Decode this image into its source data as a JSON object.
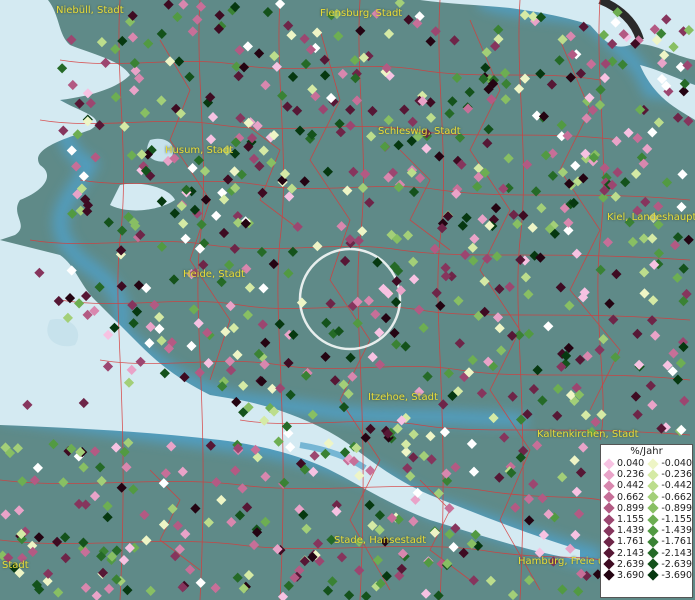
{
  "map": {
    "cities": [
      {
        "label": "Niebüll, Stadt"
      },
      {
        "label": "Flensburg, Stadt"
      },
      {
        "label": "Schleswig, Stadt"
      },
      {
        "label": "Husum, Stadt"
      },
      {
        "label": "Kiel, Landeshauptstadt"
      },
      {
        "label": "Heide, Stadt"
      },
      {
        "label": "Itzehoe, Stadt"
      },
      {
        "label": "Kaltenkirchen, Stadt"
      },
      {
        "label": "Stade, Hansestadt"
      },
      {
        "label": "Hamburg, Freie und Hansestadt"
      },
      {
        "label": "Stadt"
      }
    ],
    "colors": {
      "water": "#d4eaf2",
      "land": "#5f8a88",
      "coast_glow": "#4fa0c8",
      "borders": "#d83a3a",
      "city_label": "#e8dc3a",
      "selection_circle": "#ffffff"
    }
  },
  "legend": {
    "title": "%/Jahr",
    "positive": [
      {
        "label": "0.040",
        "color": "#f7c2e2"
      },
      {
        "label": "0.236",
        "color": "#e9a3c8"
      },
      {
        "label": "0.442",
        "color": "#d987ae"
      },
      {
        "label": "0.662",
        "color": "#c76f98"
      },
      {
        "label": "0.899",
        "color": "#b35a83"
      },
      {
        "label": "1.155",
        "color": "#9c4670"
      },
      {
        "label": "1.439",
        "color": "#86355d"
      },
      {
        "label": "1.761",
        "color": "#6e2548"
      },
      {
        "label": "2.143",
        "color": "#561735"
      },
      {
        "label": "2.639",
        "color": "#3e0b22"
      },
      {
        "label": "3.690",
        "color": "#240412"
      }
    ],
    "negative": [
      {
        "label": "-0.040",
        "color": "#eef5c6"
      },
      {
        "label": "-0.236",
        "color": "#d5eaa5"
      },
      {
        "label": "-0.442",
        "color": "#bcdd8c"
      },
      {
        "label": "-0.662",
        "color": "#a3cf78"
      },
      {
        "label": "-0.899",
        "color": "#88bf63"
      },
      {
        "label": "-1.155",
        "color": "#6dae52"
      },
      {
        "label": "-1.439",
        "color": "#529a42"
      },
      {
        "label": "-1.761",
        "color": "#3a8234"
      },
      {
        "label": "-2.143",
        "color": "#256a27"
      },
      {
        "label": "-2.639",
        "color": "#14521b"
      },
      {
        "label": "-3.690",
        "color": "#063810"
      }
    ]
  }
}
